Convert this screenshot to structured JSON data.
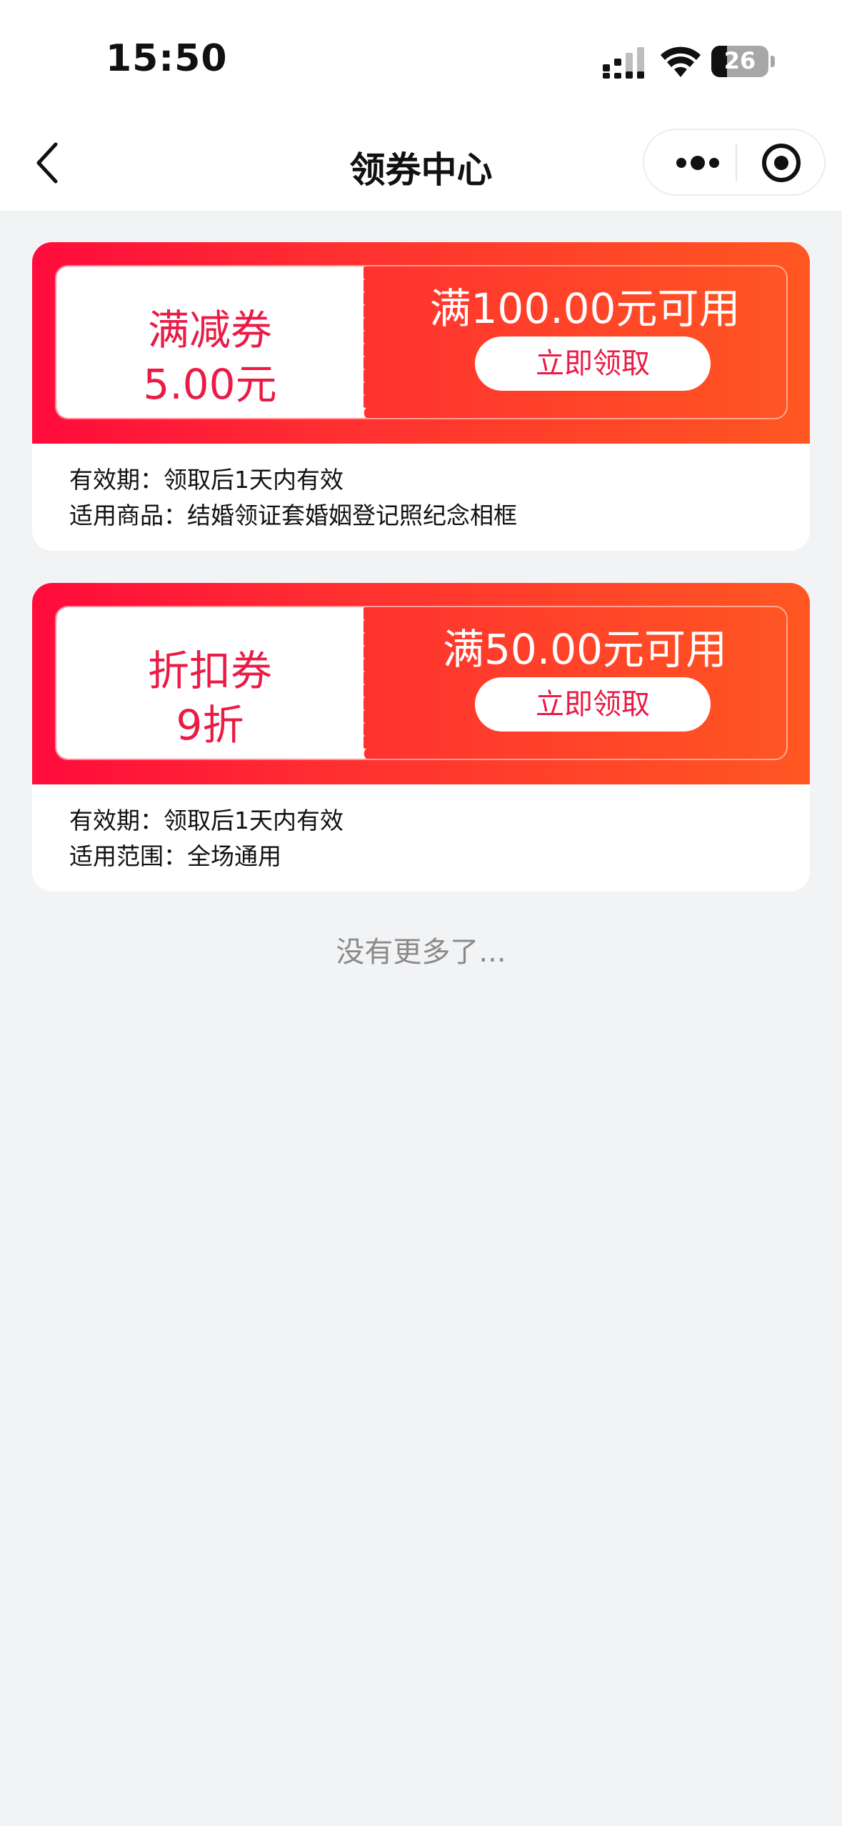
{
  "status_bar": {
    "time": "15:50",
    "battery": "26"
  },
  "nav": {
    "title": "领券中心",
    "back_icon": "chevron-left-icon",
    "more_icon": "more-dots-icon",
    "close_icon": "target-circle-icon"
  },
  "colors": {
    "accent": "#ea1b45",
    "gradient_start": "#ff0b3c",
    "gradient_end": "#ff5722",
    "page_bg": "#f2f3f5"
  },
  "coupons": [
    {
      "type": "满减券",
      "value": "5.00元",
      "condition": "满100.00元可用",
      "button": "立即领取",
      "validity_label": "有效期：",
      "validity": "领取后1天内有效",
      "scope_label": "适用商品：",
      "scope": "结婚领证套婚姻登记照纪念相框"
    },
    {
      "type": "折扣券",
      "value": "9折",
      "condition": "满50.00元可用",
      "button": "立即领取",
      "validity_label": "有效期：",
      "validity": "领取后1天内有效",
      "scope_label": "适用范围：",
      "scope": "全场通用"
    }
  ],
  "footer": {
    "text": "没有更多了..."
  }
}
